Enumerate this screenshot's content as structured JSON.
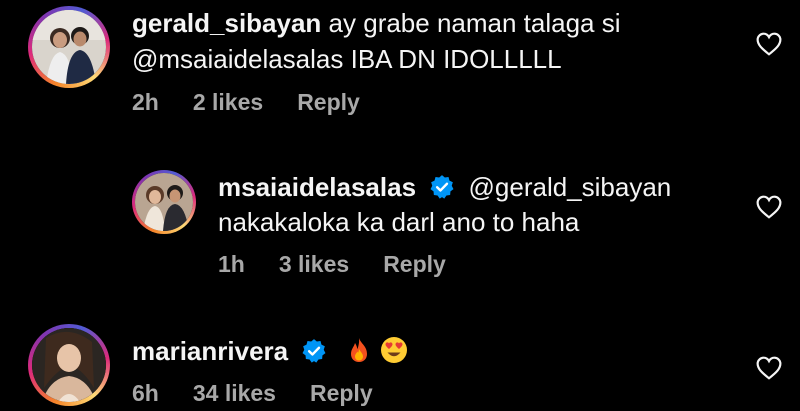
{
  "comments": [
    {
      "username": "gerald_sibayan",
      "line1": "ay grabe naman talaga si",
      "line2": "@msaiaidelasalas IBA DN IDOLLLLL",
      "time": "2h",
      "likes": "2 likes",
      "reply": "Reply"
    },
    {
      "username": "msaiaidelasalas",
      "mention": "@gerald_sibayan",
      "line2": "nakakaloka ka darl ano to haha",
      "time": "1h",
      "likes": "3 likes",
      "reply": "Reply"
    },
    {
      "username": "marianrivera",
      "time": "6h",
      "likes": "34 likes",
      "reply": "Reply"
    }
  ],
  "icons": {
    "heart": "heart-outline-icon",
    "verified": "verified-badge-icon",
    "fire": "fire-emoji",
    "heart_eyes": "heart-eyes-emoji"
  },
  "colors": {
    "background": "#000000",
    "text": "#f5f5f5",
    "muted": "#a8a8a8",
    "verified": "#0095f6"
  }
}
